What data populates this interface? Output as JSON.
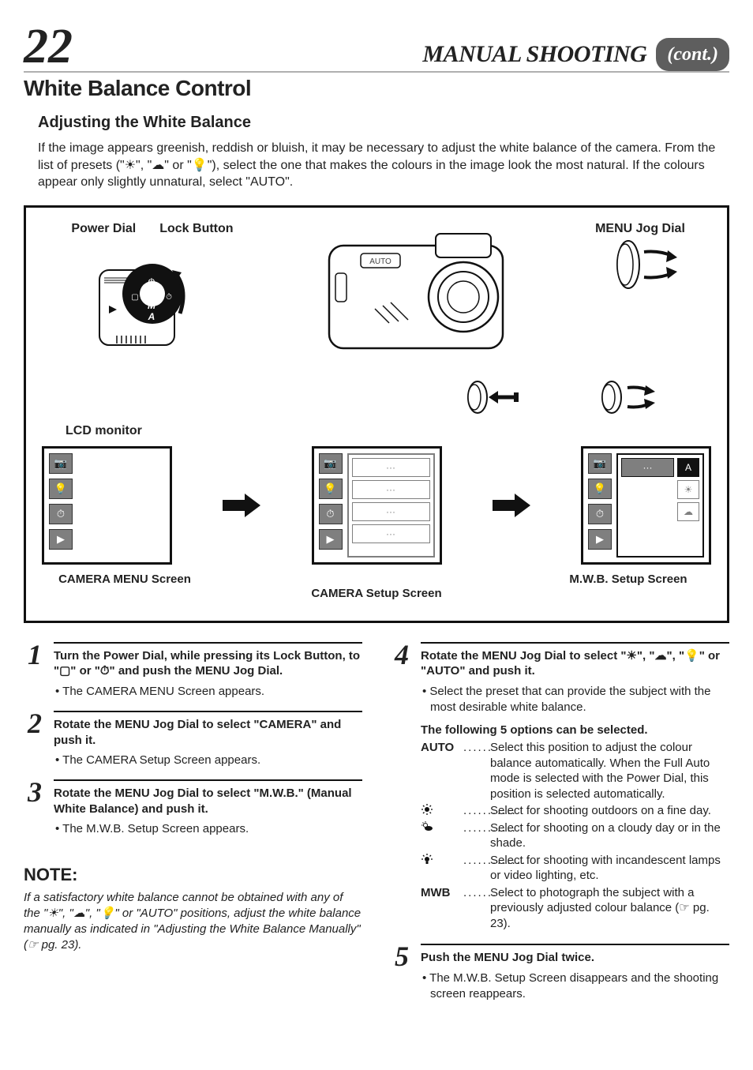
{
  "header": {
    "page_number": "22",
    "chapter_title": "MANUAL SHOOTING",
    "cont_label": "(cont.)"
  },
  "section": {
    "title": "White Balance Control",
    "subtitle": "Adjusting the White Balance",
    "intro": "If the image appears greenish, reddish or bluish, it may be necessary to adjust the white balance of the camera. From the list of presets (\"☀\", \"☁\" or \"💡\"), select the one that makes the colours in the image look the most natural. If the colours appear only slightly unnatural, select \"AUTO\"."
  },
  "diagram": {
    "power_dial_label": "Power Dial",
    "lock_button_label": "Lock Button",
    "menu_jog_label": "MENU Jog Dial",
    "lcd_label": "LCD monitor",
    "captions": {
      "left": "CAMERA MENU Screen",
      "center": "CAMERA Setup Screen",
      "right": "M.W.B. Setup Screen"
    }
  },
  "steps_left": [
    {
      "num": "1",
      "title": "Turn the Power Dial, while pressing its Lock Button, to \"▢\" or \"⏱\" and push the MENU Jog Dial.",
      "bullet": "The CAMERA MENU Screen appears."
    },
    {
      "num": "2",
      "title": "Rotate the MENU Jog Dial to select \"CAMERA\" and push it.",
      "bullet": "The CAMERA Setup Screen appears."
    },
    {
      "num": "3",
      "title": "Rotate the MENU Jog Dial to select \"M.W.B.\" (Manual White Balance) and push it.",
      "bullet": "The M.W.B. Setup Screen appears."
    }
  ],
  "note": {
    "heading": "NOTE:",
    "body": "If a satisfactory white balance cannot be obtained with any of the \"☀\", \"☁\", \"💡\" or \"AUTO\" positions, adjust the white balance manually as indicated in \"Adjusting the White Balance Manually\" (☞ pg. 23)."
  },
  "steps_right": [
    {
      "num": "4",
      "title": "Rotate the MENU Jog Dial to select \"☀\", \"☁\", \"💡\" or \"AUTO\" and push it.",
      "bullet": "Select the preset that can provide the subject with the most desirable white balance."
    },
    {
      "num": "5",
      "title": "Push the MENU Jog Dial twice.",
      "bullet": "The M.W.B. Setup Screen disappears and the shooting screen reappears."
    }
  ],
  "options": {
    "intro": "The following 5 options can be selected.",
    "items": [
      {
        "key": "AUTO",
        "dots": "......",
        "desc": "Select this position to adjust the colour balance automatically. When the Full Auto mode is selected with the Power Dial, this position is selected automatically."
      },
      {
        "key_icon": "sun",
        "dots": "...........",
        "desc": "Select for shooting outdoors on a fine day."
      },
      {
        "key_icon": "cloud",
        "dots": "...........",
        "desc": "Select for shooting on a cloudy day or in the shade."
      },
      {
        "key_icon": "lamp",
        "dots": ".............",
        "desc": "Select for shooting with incandescent lamps or video lighting, etc."
      },
      {
        "key": "MWB",
        "dots": ".......",
        "desc": "Select to photograph the subject with a previously adjusted colour balance (☞ pg. 23)."
      }
    ]
  }
}
